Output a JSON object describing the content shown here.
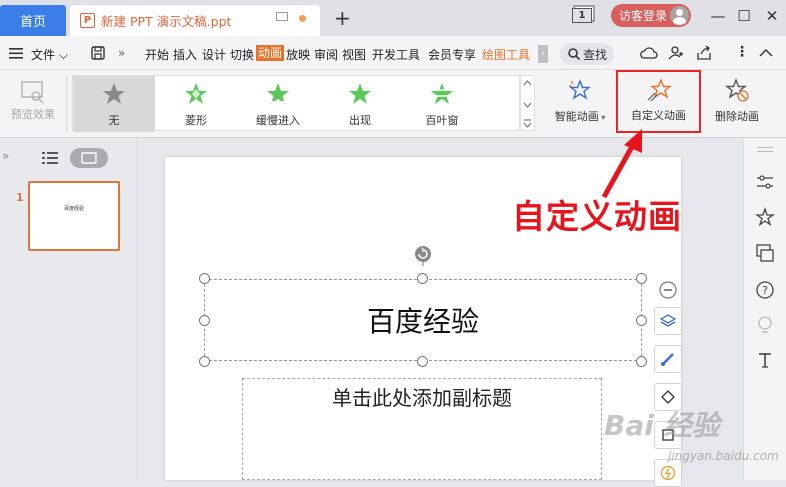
{
  "titlebar": {
    "home_tab": "首页",
    "doc_tab_icon": "P",
    "doc_title": "新建 PPT 演示文稿.ppt",
    "new_tab": "+",
    "page_badge": "1",
    "login": "访客登录",
    "minimize": "—",
    "maximize": "☐",
    "close": "✕"
  },
  "menubar": {
    "file": "文件",
    "tabs": [
      "开始",
      "插入",
      "设计",
      "切换",
      "动画",
      "放映",
      "审阅",
      "视图",
      "开发工具",
      "会员专享",
      "绘图工具"
    ],
    "active_tab": "动画",
    "search": "查找"
  },
  "ribbon": {
    "preview": "预览效果",
    "gallery": [
      "无",
      "菱形",
      "缓慢进入",
      "出现",
      "百叶窗"
    ],
    "smart_anim": "智能动画",
    "custom_anim": "自定义动画",
    "delete_anim": "删除动画"
  },
  "slides_panel": {
    "slide_number": "1",
    "thumb_text": "百度经验"
  },
  "slide": {
    "title": "百度经验",
    "subtitle": "单击此处添加副标题"
  },
  "annotation": "自定义动画",
  "watermark": "Bai 经验",
  "watermark_url": "jingyan.baidu.com",
  "colors": {
    "accent": "#3b7de9",
    "orange": "#e5732a",
    "annotation_red": "#e8141d",
    "star_green": "#5cc85c"
  }
}
